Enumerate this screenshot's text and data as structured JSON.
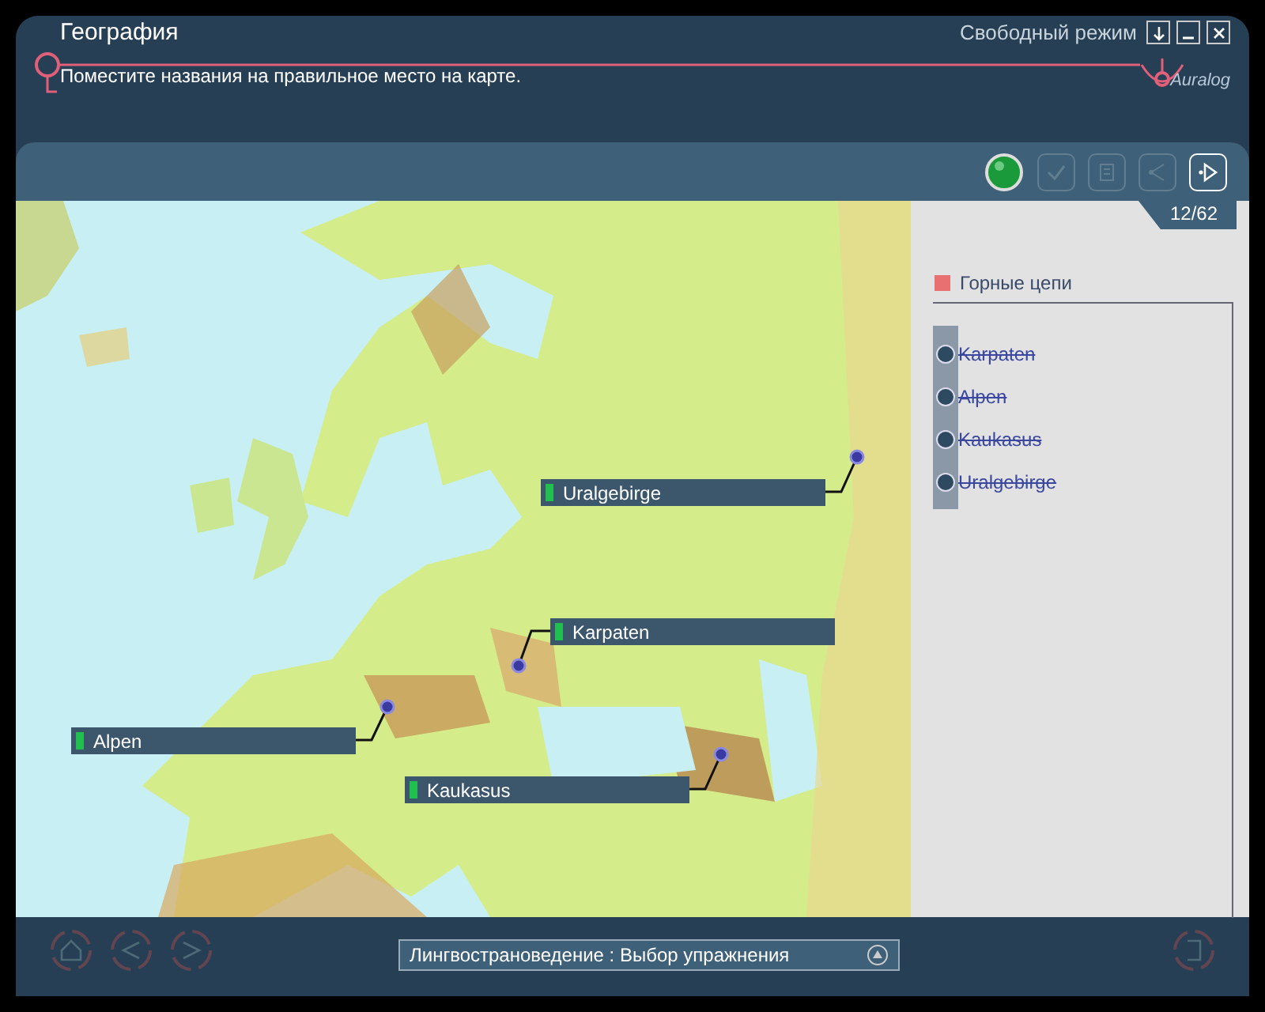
{
  "header": {
    "title": "География",
    "instruction": "Поместите названия на правильное место на карте.",
    "mode": "Свободный режим",
    "logo": "Auralog"
  },
  "toolbar": {
    "buttons": [
      {
        "kind": "status",
        "disabled": false
      },
      {
        "kind": "check",
        "disabled": true
      },
      {
        "kind": "hint",
        "disabled": true
      },
      {
        "kind": "share",
        "disabled": true
      },
      {
        "kind": "next",
        "disabled": false
      }
    ],
    "progress": "12/62"
  },
  "map_labels": [
    {
      "text": "Uralgebirge",
      "correct": true
    },
    {
      "text": "Karpaten",
      "correct": true
    },
    {
      "text": "Alpen",
      "correct": true
    },
    {
      "text": "Kaukasus",
      "correct": true
    }
  ],
  "side_panel": {
    "category": {
      "label": "Горные цепи",
      "color": "#e87070"
    },
    "words": [
      {
        "text": "Karpaten",
        "used": true
      },
      {
        "text": "Alpen",
        "used": true
      },
      {
        "text": "Kaukasus",
        "used": true
      },
      {
        "text": "Uralgebirge",
        "used": true
      }
    ]
  },
  "footer": {
    "nav_buttons": [
      {
        "kind": "home",
        "disabled": true
      },
      {
        "kind": "back",
        "disabled": true
      },
      {
        "kind": "forward",
        "disabled": true
      }
    ],
    "breadcrumb": "Лингвострановедение : Выбор упражнения",
    "end_button": {
      "disabled": true
    }
  }
}
